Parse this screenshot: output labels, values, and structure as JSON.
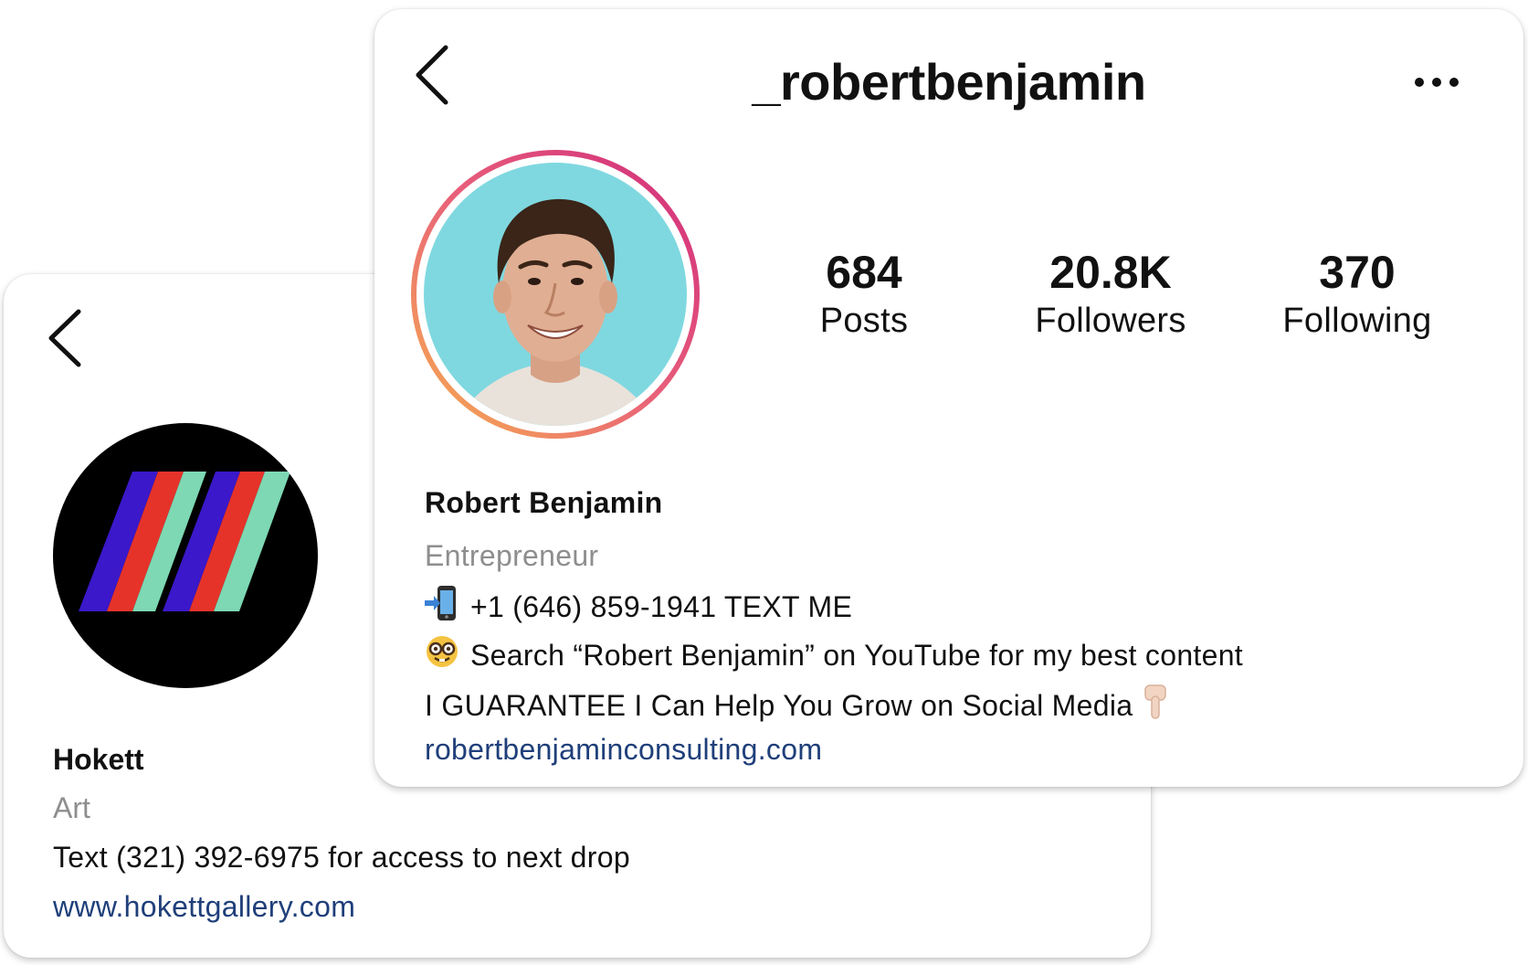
{
  "hokett": {
    "name": "Hokett",
    "category": "Art",
    "bio": "Text (321) 392-6975 for access to next drop",
    "link": "www.hokettgallery.com",
    "icons": {
      "back": "chevron-left-icon",
      "avatar": "hokett-logo"
    },
    "colors": {
      "stripe_blue": "#3b18c9",
      "stripe_red": "#e5332a",
      "stripe_green": "#7dd8b3",
      "avatar_bg": "#000000",
      "link": "#1f3f7a"
    }
  },
  "robert": {
    "username": "_robertbenjamin",
    "stats": {
      "posts": {
        "value": "684",
        "label": "Posts"
      },
      "followers": {
        "value": "20.8K",
        "label": "Followers"
      },
      "following": {
        "value": "370",
        "label": "Following"
      }
    },
    "name": "Robert Benjamin",
    "category": "Entrepreneur",
    "bio_lines": [
      {
        "icon": "mobile-phone-arrow-icon",
        "text": "+1 (646) 859-1941 TEXT ME"
      },
      {
        "icon": "nerd-face-icon",
        "text": "Search “Robert Benjamin” on YouTube for my best content"
      },
      {
        "text": "I GUARANTEE I Can Help You Grow on Social Media",
        "icon_after": "pointing-down-hand-icon"
      }
    ],
    "link": "robertbenjaminconsulting.com",
    "icons": {
      "back": "chevron-left-icon",
      "more": "more-options-icon",
      "avatar": "profile-photo"
    },
    "colors": {
      "story_ring_start": "#f6b04d",
      "story_ring_end": "#d02a7c",
      "avatar_bg": "#7fd8e0",
      "link": "#1f3f7a"
    }
  }
}
